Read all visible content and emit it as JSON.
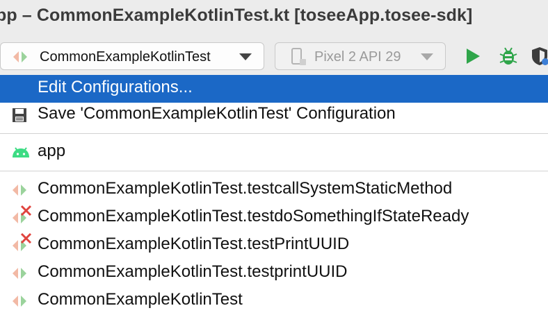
{
  "window": {
    "title": "pp – CommonExampleKotlinTest.kt [toseeApp.tosee-sdk]"
  },
  "toolbar": {
    "run_config": "CommonExampleKotlinTest",
    "device": "Pixel 2 API 29",
    "icons": [
      "kotlin-test-icon",
      "phone-icon",
      "run-icon",
      "debug-icon",
      "profile-icon"
    ],
    "colors": {
      "run": "#2fa54a",
      "debug": "#2fa54a",
      "profile": "#3d7fd6"
    }
  },
  "menu": {
    "edit": "Edit Configurations...",
    "save": "Save 'CommonExampleKotlinTest' Configuration",
    "app": "app",
    "configs": [
      {
        "label": "CommonExampleKotlinTest.testcallSystemStaticMethod",
        "error": false
      },
      {
        "label": "CommonExampleKotlinTest.testdoSomethingIfStateReady",
        "error": true
      },
      {
        "label": "CommonExampleKotlinTest.testPrintUUID",
        "error": true
      },
      {
        "label": "CommonExampleKotlinTest.testprintUUID",
        "error": false
      },
      {
        "label": "CommonExampleKotlinTest",
        "error": false
      }
    ],
    "colors": {
      "selected": "#1b68c6",
      "android": "#3ddc84",
      "error": "#e0443e"
    }
  }
}
